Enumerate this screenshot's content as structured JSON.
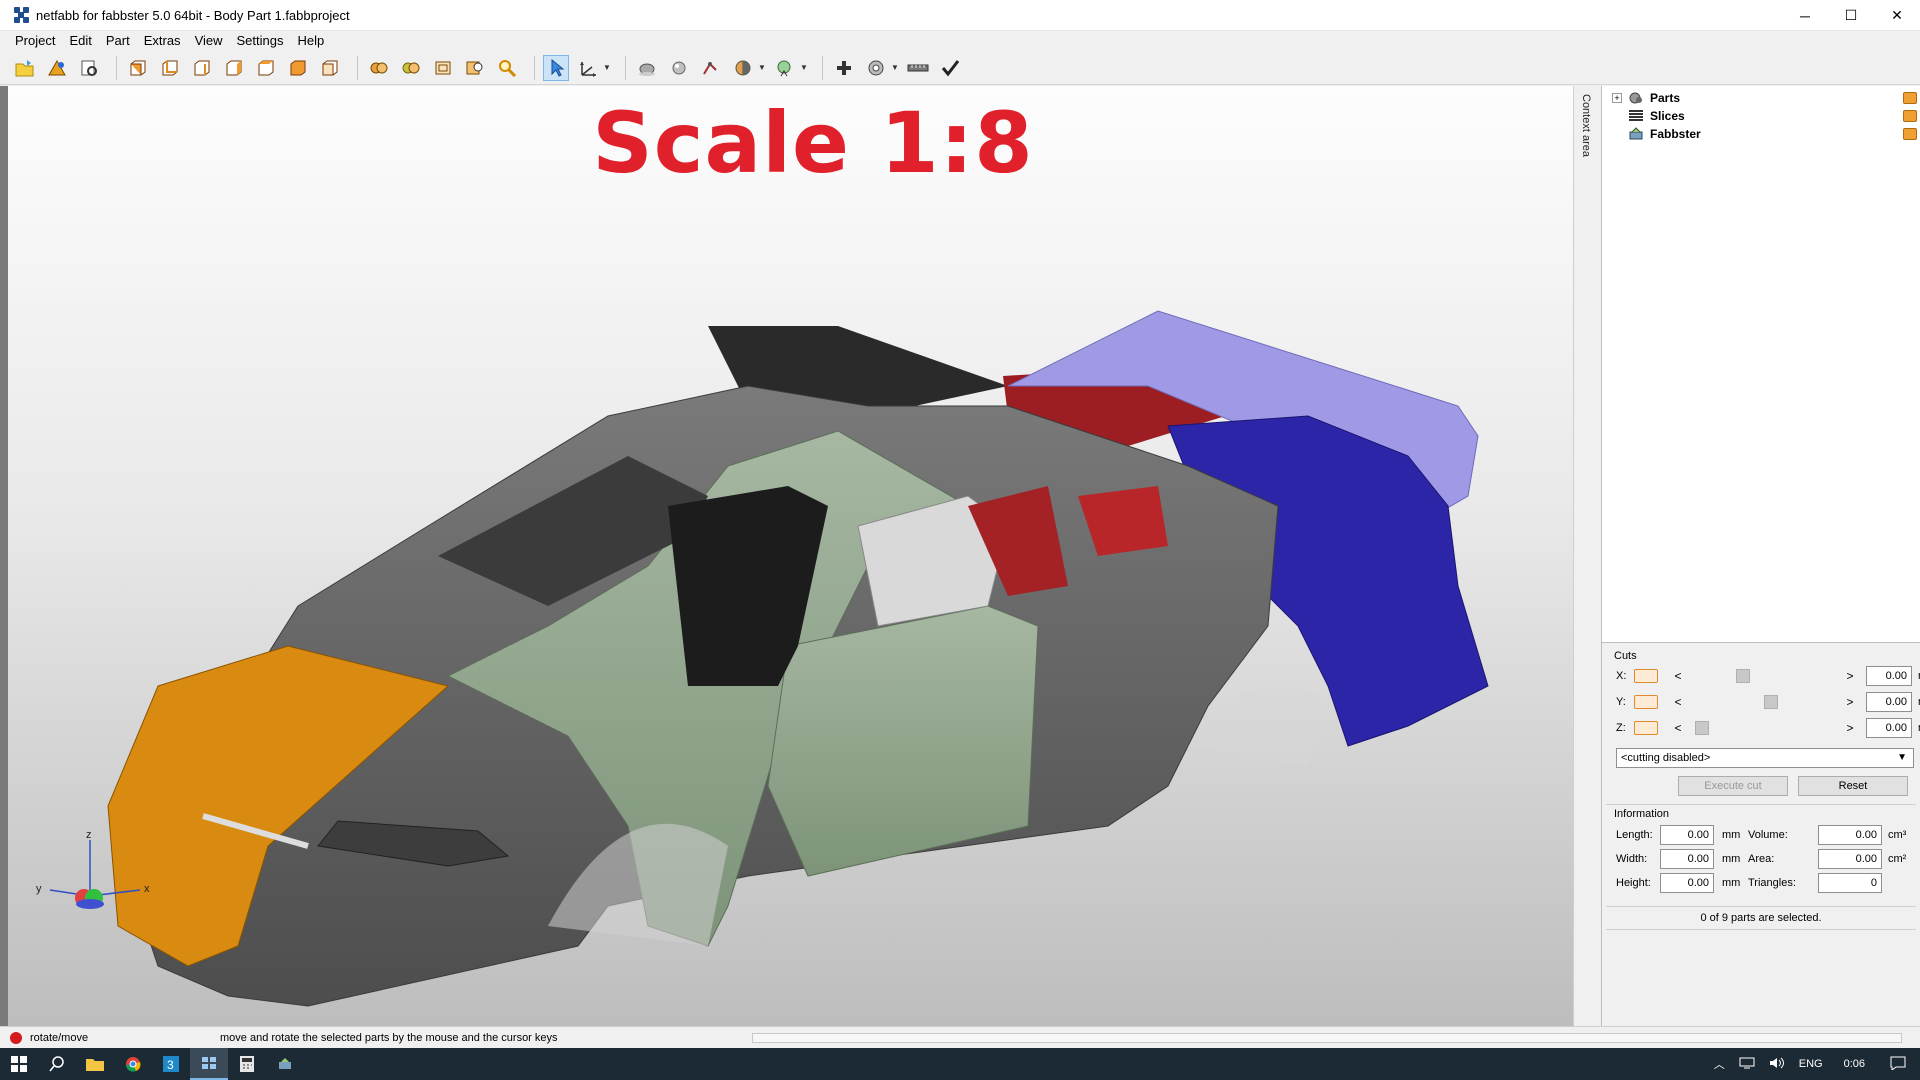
{
  "window": {
    "title": "netfabb for fabbster 5.0 64bit - Body Part 1.fabbproject",
    "minimize": "─",
    "maximize": "☐",
    "close": "✕"
  },
  "menu": [
    "Project",
    "Edit",
    "Part",
    "Extras",
    "View",
    "Settings",
    "Help"
  ],
  "viewport": {
    "annotation": "Scale 1:8",
    "axis_labels": {
      "x": "x",
      "y": "y",
      "z": "z"
    },
    "colors": {
      "front": "#d98a10",
      "side": "#8fa58a",
      "body": "#666666",
      "rear": "#2a26a8",
      "spoiler": "#9a94e0",
      "interior": "#a82226"
    }
  },
  "context_area_label": "Context area",
  "tree": {
    "items": [
      {
        "label": "Parts",
        "expander": "+"
      },
      {
        "label": "Slices",
        "expander": ""
      },
      {
        "label": "Fabbster",
        "expander": ""
      }
    ]
  },
  "cuts": {
    "title": "Cuts",
    "rows": [
      {
        "axis": "X:",
        "value": "0.00",
        "unit": "mm",
        "thumb": 0.35
      },
      {
        "axis": "Y:",
        "value": "0.00",
        "unit": "mm",
        "thumb": 0.55
      },
      {
        "axis": "Z:",
        "value": "0.00",
        "unit": "mm",
        "thumb": 0.05
      }
    ],
    "left_arrow": "<",
    "right_arrow": ">",
    "mode": "<cutting disabled>",
    "execute_label": "Execute cut",
    "reset_label": "Reset"
  },
  "information": {
    "title": "Information",
    "length": {
      "label": "Length:",
      "value": "0.00",
      "unit": "mm"
    },
    "width": {
      "label": "Width:",
      "value": "0.00",
      "unit": "mm"
    },
    "height": {
      "label": "Height:",
      "value": "0.00",
      "unit": "mm"
    },
    "volume": {
      "label": "Volume:",
      "value": "0.00",
      "unit": "cm³"
    },
    "area": {
      "label": "Area:",
      "value": "0.00",
      "unit": "cm²"
    },
    "triangles": {
      "label": "Triangles:",
      "value": "0"
    }
  },
  "selection_status": "0 of 9 parts are selected.",
  "statusbar": {
    "mode": "rotate/move",
    "hint": "move and rotate the selected parts by the mouse and the cursor keys"
  },
  "taskbar": {
    "language": "ENG",
    "time": "0:06"
  }
}
